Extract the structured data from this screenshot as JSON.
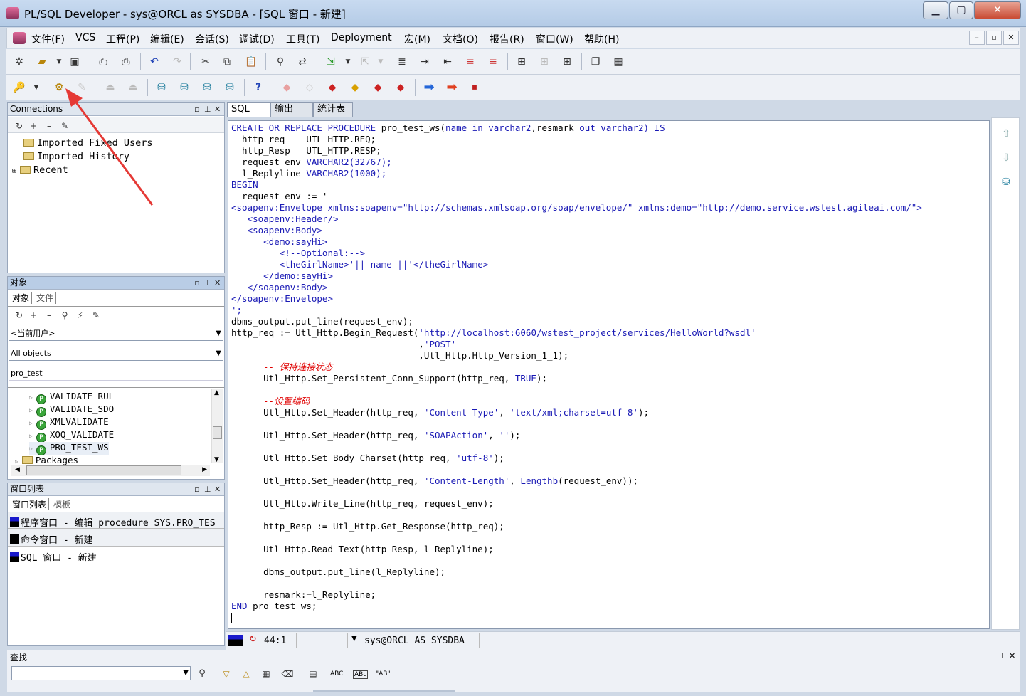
{
  "window": {
    "title": "PL/SQL Developer - sys@ORCL as SYSDBA - [SQL 窗口 - 新建]",
    "min": "▁",
    "max": "▢",
    "close": "✕"
  },
  "menu": [
    "文件(F)",
    "VCS",
    "工程(P)",
    "编辑(E)",
    "会话(S)",
    "调试(D)",
    "工具(T)",
    "Deployment",
    "宏(M)",
    "文档(O)",
    "报告(R)",
    "窗口(W)",
    "帮助(H)"
  ],
  "mdi": {
    "min": "–",
    "restore": "▫",
    "close": "✕"
  },
  "connections": {
    "title": "Connections",
    "items": [
      "Imported Fixed Users",
      "Imported History",
      "Recent"
    ]
  },
  "objects": {
    "title": "对象",
    "tabs": [
      "对象",
      "文件"
    ],
    "user_select": "<当前用户>",
    "filter_select": "All objects",
    "search_value": "pro_test",
    "items": [
      "VALIDATE_RUL",
      "VALIDATE_SDO",
      "XMLVALIDATE",
      "XOQ_VALIDATE",
      "PRO_TEST_WS"
    ],
    "folder": "Packages"
  },
  "window_list": {
    "title": "窗口列表",
    "tabs": [
      "窗口列表",
      "模板"
    ],
    "items": [
      "程序窗口 - 编辑 procedure SYS.PRO_TES",
      "命令窗口 - 新建",
      "SQL 窗口 - 新建"
    ]
  },
  "editor_tabs": [
    "SQL",
    "输出",
    "统计表"
  ],
  "status": {
    "position": "44:1",
    "connection": "sys@ORCL AS SYSDBA"
  },
  "find": {
    "title": "查找",
    "buttons": [
      "ABC",
      "ABc",
      "\"AB\""
    ]
  },
  "code": {
    "l1a": "CREATE OR REPLACE PROCEDURE",
    "l1b": " pro_test_ws(",
    "l1c": "name in varchar2",
    "l1d": ",resmark ",
    "l1e": "out varchar2",
    "l1f": ") IS",
    "l2": "  http_req    UTL_HTTP.REQ;",
    "l3": "  http_Resp   UTL_HTTP.RESP;",
    "l4a": "  request_env ",
    "l4b": "VARCHAR2(32767);",
    "l5a": "  l_Replyline ",
    "l5b": "VARCHAR2(1000);",
    "l6": "BEGIN",
    "l7": "  request_env := '",
    "l8": "<soapenv:Envelope xmlns:soapenv=\"http://schemas.xmlsoap.org/soap/envelope/\" xmlns:demo=\"http://demo.service.wstest.agileai.com/\">",
    "l9": "   <soapenv:Header/>",
    "l10": "   <soapenv:Body>",
    "l11": "      <demo:sayHi>",
    "l12": "         <!--Optional:-->",
    "l13a": "         <theGirlName>'|| ",
    "l13b": "name",
    "l13c": " ||'</theGirlName>",
    "l14": "      </demo:sayHi>",
    "l15": "   </soapenv:Body>",
    "l16": "</soapenv:Envelope>",
    "l17": "';",
    "l18": "dbms_output.put_line(request_env);",
    "l19a": "http_req := Utl_Http.Begin_Request(",
    "l19b": "'http://localhost:6060/wstest_project/services/HelloWorld?wsdl'",
    "l20a": "                                   ,",
    "l20b": "'POST'",
    "l21": "                                   ,Utl_Http.Http_Version_1_1);",
    "l22": "      -- 保持连接状态",
    "l23a": "      Utl_Http.Set_Persistent_Conn_Support(http_req, ",
    "l23b": "TRUE",
    "l23c": ");",
    "l24": "      --设置编码",
    "l25a": "      Utl_Http.Set_Header(http_req, ",
    "l25b": "'Content-Type'",
    "l25c": ", ",
    "l25d": "'text/xml;charset=utf-8'",
    "l25e": ");",
    "l26a": "      Utl_Http.Set_Header(http_req, ",
    "l26b": "'SOAPAction'",
    "l26c": ", ",
    "l26d": "''",
    "l26e": ");",
    "l27a": "      Utl_Http.Set_Body_Charset(http_req, ",
    "l27b": "'utf-8'",
    "l27c": ");",
    "l28a": "      Utl_Http.Set_Header(http_req, ",
    "l28b": "'Content-Length'",
    "l28c": ", ",
    "l28d": "Lengthb",
    "l28e": "(request_env));",
    "l29": "      Utl_Http.Write_Line(http_req, request_env);",
    "l30": "      http_Resp := Utl_Http.Get_Response(http_req);",
    "l31": "      Utl_Http.Read_Text(http_Resp, l_Replyline);",
    "l32": "      dbms_output.put_line(l_Replyline);",
    "l33": "      resmark:=l_Replyline;",
    "l34a": "END",
    "l34b": " pro_test_ws;"
  },
  "colors": {
    "keyword": "#1a1ab5",
    "comment": "#e00000",
    "annotation_arrow": "#e53935"
  }
}
